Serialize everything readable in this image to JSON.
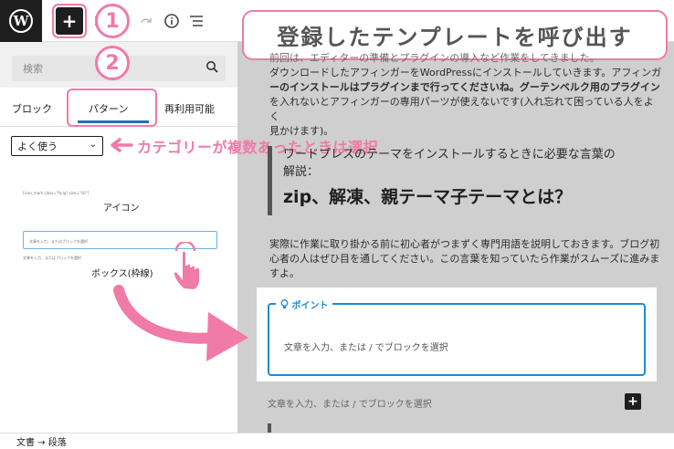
{
  "toolbar": {
    "logo_letter": "W",
    "add_symbol": "+",
    "list_view_icon": "list-view-icon",
    "undo_icon": "undo-icon",
    "redo_icon": "redo-icon",
    "info_icon": "info-icon",
    "outline_icon": "outline-icon"
  },
  "annotations": {
    "callout_title": "登録したテンプレートを呼び出す",
    "step1": "1",
    "step2": "2",
    "category_note": "カテゴリーが複数あったときは選択",
    "accent_color": "#f07aa8"
  },
  "inserter": {
    "search_placeholder": "検索",
    "tabs": [
      {
        "label": "ブロック",
        "active": false
      },
      {
        "label": "パターン",
        "active": true
      },
      {
        "label": "再利用可能",
        "active": false
      }
    ],
    "category_select": "よく使う",
    "patterns": [
      {
        "title": "アイコン",
        "preview_text": "[icon_mark class=\"fa-lg\" size=\"16\"]"
      },
      {
        "title": "ボックス(枠線)",
        "preview_text": "文章を入力、またはブロックを選択"
      }
    ]
  },
  "editor": {
    "intro_paragraph": {
      "line1": "前回は、エディターの準備とプラグインの導入など作業をしてきました。",
      "line2": "ダウンロードしたアフィンガーをWordPressにインストールしていきます。アフィンガ",
      "line3": "ーのインストールはプラグインまで行ってくださいね。グーテンベルク用のプラグイン",
      "line4": "を入れないとアフィンガーの専用パーツが使えないです(入れ忘れて困っている人をよく",
      "line5": "見かけます)。"
    },
    "quote": {
      "small": "ワードプレスのテーマをインストールするときに必要な言葉の",
      "small2": "解説：",
      "big": "zip、解凍、親テーマ子テーマとは？"
    },
    "paragraph2": {
      "line1": "実際に作業に取り掛かる前に初心者がつまずく専門用語を説明しておきます。ブログ初",
      "line2": "心者の人はぜひ目を通してください。この言葉を知っていたら作業がスムーズに進みま",
      "line3": "すよ。"
    },
    "point_box": {
      "label": "ポイント",
      "placeholder": "文章を入力、または / でブロックを選択",
      "border_color": "#1e8ccf"
    },
    "empty_block_placeholder": "文章を入力、または / でブロックを選択",
    "add_block_symbol": "+"
  },
  "statusbar": {
    "breadcrumb": "文書 → 段落"
  }
}
